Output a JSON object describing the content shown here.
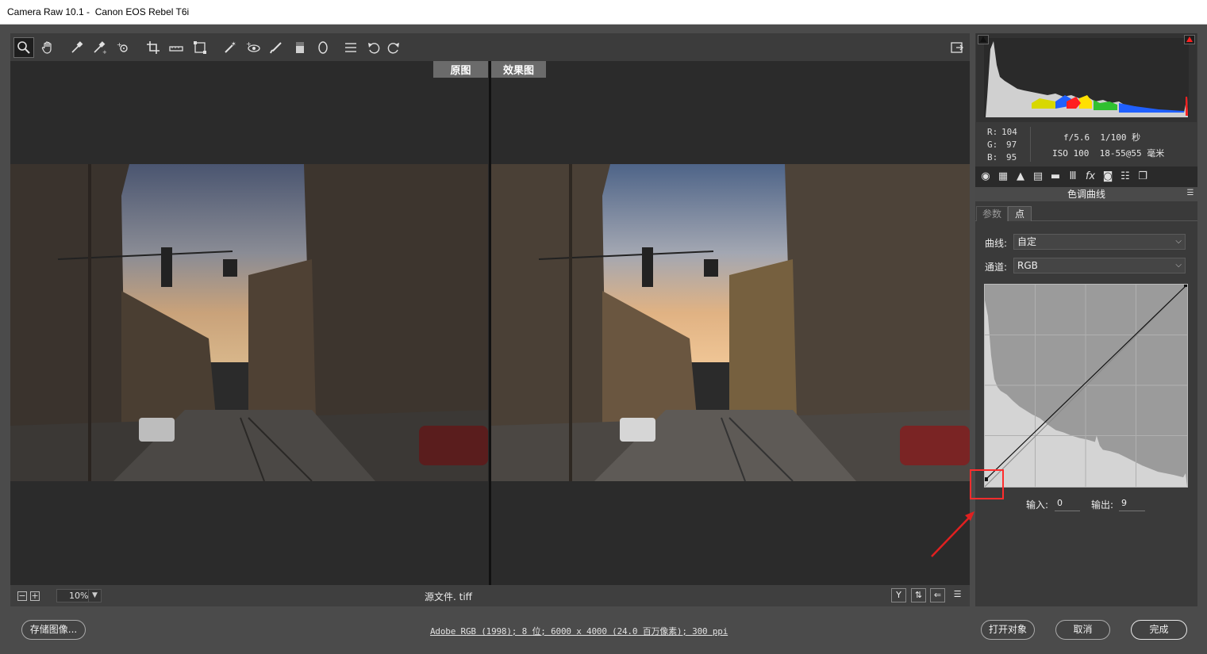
{
  "window": {
    "title": "Camera Raw 10.1 -  Canon EOS Rebel T6i"
  },
  "toolbar": {
    "tools": [
      {
        "name": "zoom-tool-icon",
        "glyph": "🔍"
      },
      {
        "name": "hand-tool-icon",
        "glyph": "✋"
      },
      {
        "name": "white-balance-tool-icon",
        "glyph": "✎"
      },
      {
        "name": "color-sampler-tool-icon",
        "glyph": "✎"
      },
      {
        "name": "targeted-adjustment-tool-icon",
        "glyph": "⊕"
      },
      {
        "name": "crop-tool-icon",
        "glyph": "⌗"
      },
      {
        "name": "straighten-tool-icon",
        "glyph": "▭"
      },
      {
        "name": "transform-tool-icon",
        "glyph": "⧈"
      },
      {
        "name": "spot-removal-tool-icon",
        "glyph": "✶"
      },
      {
        "name": "red-eye-removal-icon",
        "glyph": "◉"
      },
      {
        "name": "adjustment-brush-icon",
        "glyph": "╱"
      },
      {
        "name": "graduated-filter-icon",
        "glyph": "▮"
      },
      {
        "name": "radial-filter-icon",
        "glyph": "○"
      },
      {
        "name": "preferences-icon",
        "glyph": "☰"
      },
      {
        "name": "rotate-left-icon",
        "glyph": "↺"
      },
      {
        "name": "rotate-right-icon",
        "glyph": "↻"
      }
    ],
    "fullscreen_icon": "⇱"
  },
  "preview": {
    "before_label": "原图",
    "after_label": "效果图",
    "zoom_value": "10%",
    "filename": "源文件. tiff"
  },
  "histogram": {
    "rgb_readout": {
      "r_label": "R:",
      "r": "104",
      "g_label": "G:",
      "g": "97",
      "b_label": "B:",
      "b": "95"
    },
    "exif_line1": "f/5.6  1/100 秒",
    "exif_line2": "ISO 100  18-55@55 毫米"
  },
  "panel": {
    "title": "色调曲线",
    "subtabs": {
      "parametric": "参数",
      "point": "点"
    },
    "curve_label": "曲线:",
    "curve_value": "自定",
    "channel_label": "通道:",
    "channel_value": "RGB",
    "input_label": "输入:",
    "input_value": "0",
    "output_label": "输出:",
    "output_value": "9"
  },
  "footer": {
    "save_button": "存储图像...",
    "workflow_info": "Adobe RGB (1998); 8 位; 6000 x 4000 (24.0 百万像素); 300 ppi",
    "open_button": "打开对象",
    "cancel_button": "取消",
    "done_button": "完成"
  },
  "colors": {
    "highlight_box": "#ff2d2d",
    "annotation_arrow": "#e02020",
    "clipping_warning": "#ff2020"
  }
}
